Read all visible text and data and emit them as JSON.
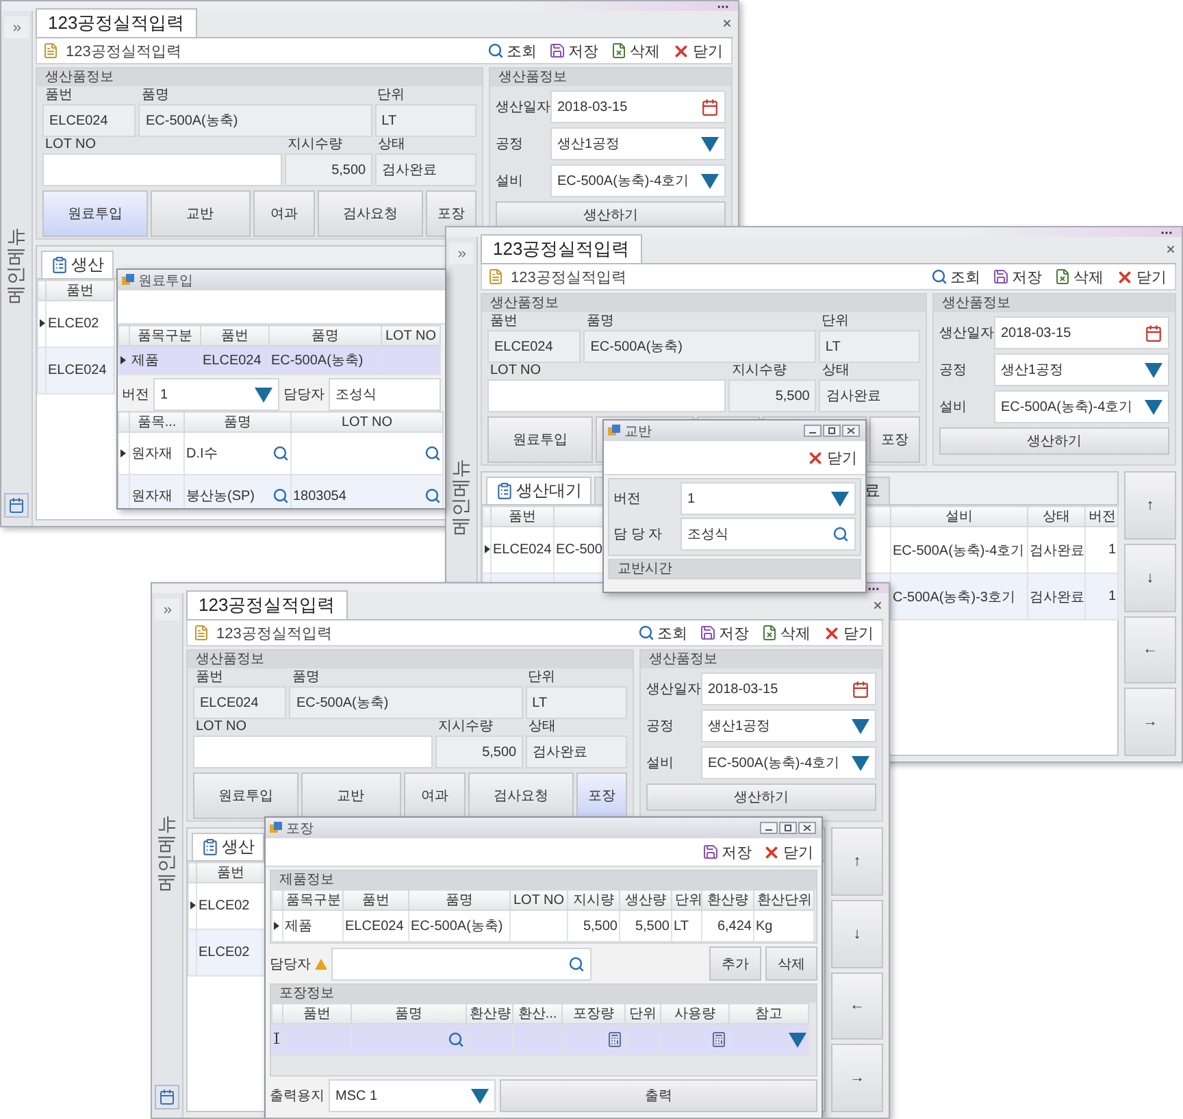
{
  "screens": [
    {
      "tab": {
        "label": "123공정실적입력",
        "selected": true
      },
      "side_menu": "메인메뉴",
      "toolbar": {
        "title": "123공정실적입력",
        "buttons": [
          {
            "kind": "search",
            "label": "조회"
          },
          {
            "kind": "save",
            "label": "저장"
          },
          {
            "kind": "delete",
            "label": "삭제"
          },
          {
            "kind": "close",
            "label": "닫기"
          }
        ]
      },
      "product_info": {
        "title": "생산품정보",
        "fields": [
          {
            "label": "품번",
            "value": "ELCE024",
            "editable": false
          },
          {
            "label": "품명",
            "value": "EC-500A(농축)",
            "editable": false
          },
          {
            "label": "단위",
            "value": "LT",
            "editable": false
          },
          {
            "label": "LOT NO",
            "editable": true
          },
          {
            "label": "지시수량",
            "value": "5,500",
            "editable": false
          },
          {
            "label": "상태",
            "value": "검사완료",
            "editable": false
          }
        ]
      },
      "steps": [
        {
          "label": "원료투입",
          "selected": true
        },
        {
          "label": "교반",
          "selected": false
        },
        {
          "label": "여과",
          "selected": false
        },
        {
          "label": "검사요청",
          "selected": false
        },
        {
          "label": "포장",
          "selected": false
        }
      ],
      "production": {
        "title": "생산품정보",
        "date_label": "생산일자",
        "date": "2018-03-15",
        "process_label": "공정",
        "process": "생산1공정",
        "equipment_label": "설비",
        "equipment": "EC-500A(농축)-4호기",
        "button": "생산하기"
      },
      "lower_tabs": [
        {
          "label": "생산",
          "selected": true
        }
      ],
      "grid": {
        "columns": [
          {
            "label": "품번"
          }
        ],
        "rows": [
          {
            "current": true,
            "selected": false,
            "cells": [
              "ELCE02"
            ]
          },
          {
            "current": false,
            "selected": false,
            "cells": [
              "ELCE024"
            ]
          }
        ]
      },
      "dialog": {
        "kind": "raw_material",
        "title": "원료투입",
        "window_controls": false,
        "product_grid": {
          "columns": [
            {
              "label": "품목구분"
            },
            {
              "label": "품번"
            },
            {
              "label": "품명"
            },
            {
              "label": "LOT NO"
            }
          ],
          "rows": [
            {
              "current": true,
              "selected": true,
              "cells": [
                "제품",
                "ELCE024",
                "EC-500A(농축)",
                null
              ]
            }
          ]
        },
        "version_label": "버전",
        "version": "1",
        "manager_label": "담당자",
        "manager": "조성식",
        "material_grid": {
          "columns": [
            {
              "label": "품목..."
            },
            {
              "label": "품명",
              "kind": "lookup"
            },
            {
              "label": "LOT NO",
              "kind": "lookup"
            }
          ],
          "rows": [
            {
              "current": true,
              "selected": false,
              "cells": [
                "원자재",
                "D.I수",
                null
              ]
            },
            {
              "current": false,
              "selected": false,
              "cells": [
                "원자재",
                "붕산농(SP)",
                "1803054"
              ]
            }
          ]
        }
      }
    },
    {
      "tab": {
        "label": "123공정실적입력",
        "selected": true
      },
      "side_menu": "메인메뉴",
      "toolbar": {
        "title": "123공정실적입력",
        "buttons": [
          {
            "kind": "search",
            "label": "조회"
          },
          {
            "kind": "save",
            "label": "저장"
          },
          {
            "kind": "delete",
            "label": "삭제"
          },
          {
            "kind": "close",
            "label": "닫기"
          }
        ]
      },
      "product_info": {
        "title": "생산품정보",
        "fields": [
          {
            "label": "품번",
            "value": "ELCE024",
            "editable": false
          },
          {
            "label": "품명",
            "value": "EC-500A(농축)",
            "editable": false
          },
          {
            "label": "단위",
            "value": "LT",
            "editable": false
          },
          {
            "label": "LOT NO",
            "editable": true
          },
          {
            "label": "지시수량",
            "value": "5,500",
            "editable": false
          },
          {
            "label": "상태",
            "value": "검사완료",
            "editable": false
          }
        ]
      },
      "steps": [
        {
          "label": "원료투입",
          "selected": false
        },
        {
          "label": "포장",
          "selected": false
        }
      ],
      "production": {
        "title": "생산품정보",
        "date_label": "생산일자",
        "date": "2018-03-15",
        "process_label": "공정",
        "process": "생산1공정",
        "equipment_label": "설비",
        "equipment": "EC-500A(농축)-4호기",
        "button": "생산하기"
      },
      "lower_tabs": [
        {
          "label": "생산대기",
          "selected": true
        },
        {
          "label": "료",
          "selected": false
        }
      ],
      "grid": {
        "columns": [
          {
            "label": "품번"
          },
          {
            "kind": "hidden"
          },
          {
            "label": "설비"
          },
          {
            "label": "상태"
          },
          {
            "label": "버전",
            "kind": "number"
          }
        ],
        "rows": [
          {
            "current": true,
            "selected": false,
            "cells": [
              "ELCE024",
              "EC-500",
              "EC-500A(농축)-4호기",
              "검사완료",
              "1"
            ]
          },
          {
            "current": false,
            "selected": false,
            "cells": [
              null,
              null,
              "C-500A(농축)-3호기",
              "검사완료",
              "1"
            ]
          }
        ]
      },
      "arrows": [
        "↑",
        "↓",
        "←",
        "→"
      ],
      "dialog": {
        "kind": "mixing",
        "title": "교반",
        "window_controls": true,
        "close_label": "닫기",
        "version_label": "버전",
        "version": "1",
        "manager_label": "담 당 자",
        "manager": "조성식",
        "section": "교반시간"
      }
    },
    {
      "tab": {
        "label": "123공정실적입력",
        "selected": true
      },
      "side_menu": "메인메뉴",
      "toolbar": {
        "title": "123공정실적입력",
        "buttons": [
          {
            "kind": "search",
            "label": "조회"
          },
          {
            "kind": "save",
            "label": "저장"
          },
          {
            "kind": "delete",
            "label": "삭제"
          },
          {
            "kind": "close",
            "label": "닫기"
          }
        ]
      },
      "product_info": {
        "title": "생산품정보",
        "fields": [
          {
            "label": "품번",
            "value": "ELCE024",
            "editable": false
          },
          {
            "label": "품명",
            "value": "EC-500A(농축)",
            "editable": false
          },
          {
            "label": "단위",
            "value": "LT",
            "editable": false
          },
          {
            "label": "LOT NO",
            "editable": true
          },
          {
            "label": "지시수량",
            "value": "5,500",
            "editable": false
          },
          {
            "label": "상태",
            "value": "검사완료",
            "editable": false
          }
        ]
      },
      "steps": [
        {
          "label": "원료투입",
          "selected": false
        },
        {
          "label": "교반",
          "selected": false
        },
        {
          "label": "여과",
          "selected": false
        },
        {
          "label": "검사요청",
          "selected": false
        },
        {
          "label": "포장",
          "selected": true
        }
      ],
      "production": {
        "title": "생산품정보",
        "date_label": "생산일자",
        "date": "2018-03-15",
        "process_label": "공정",
        "process": "생산1공정",
        "equipment_label": "설비",
        "equipment": "EC-500A(농축)-4호기",
        "button": "생산하기"
      },
      "lower_tabs": [
        {
          "label": "생산",
          "selected": true
        }
      ],
      "grid": {
        "columns": [
          {
            "label": "품번"
          }
        ],
        "rows": [
          {
            "current": true,
            "selected": false,
            "cells": [
              "ELCE02"
            ]
          },
          {
            "current": false,
            "selected": false,
            "cells": [
              "ELCE02"
            ]
          }
        ]
      },
      "arrows": [
        "↑",
        "↓",
        "←",
        "→"
      ],
      "dialog": {
        "kind": "packing",
        "title": "포장",
        "window_controls": true,
        "buttons": [
          {
            "kind": "save",
            "label": "저장"
          },
          {
            "kind": "close",
            "label": "닫기"
          }
        ],
        "product_section": "제품정보",
        "product_grid": {
          "columns": [
            {
              "label": "품목구분"
            },
            {
              "label": "품번"
            },
            {
              "label": "품명"
            },
            {
              "label": "LOT NO"
            },
            {
              "label": "지시량",
              "kind": "number"
            },
            {
              "label": "생산량",
              "kind": "number"
            },
            {
              "label": "단위"
            },
            {
              "label": "환산량",
              "kind": "number"
            },
            {
              "label": "환산단위"
            }
          ],
          "rows": [
            {
              "current": true,
              "selected": false,
              "cells": [
                "제품",
                "ELCE024",
                "EC-500A(농축)",
                null,
                "5,500",
                "5,500",
                "LT",
                "6,424",
                "Kg"
              ]
            }
          ]
        },
        "manager_label": "담당자",
        "manager_required": true,
        "add_button": "추가",
        "delete_button": "삭제",
        "packing_section": "포장정보",
        "packing_grid": {
          "columns": [
            {
              "label": "품번"
            },
            {
              "label": "품명",
              "kind": "lookup"
            },
            {
              "label": "환산량"
            },
            {
              "label": "환산..."
            },
            {
              "label": "포장량",
              "kind": "calc"
            },
            {
              "label": "단위"
            },
            {
              "label": "사용량",
              "kind": "calc"
            },
            {
              "label": "참고",
              "kind": "combo"
            }
          ],
          "rows": [
            {
              "kind": "new",
              "selected": true
            }
          ]
        },
        "paper_label": "출력용지",
        "paper": "MSC 1",
        "print_button": "출력"
      }
    }
  ]
}
